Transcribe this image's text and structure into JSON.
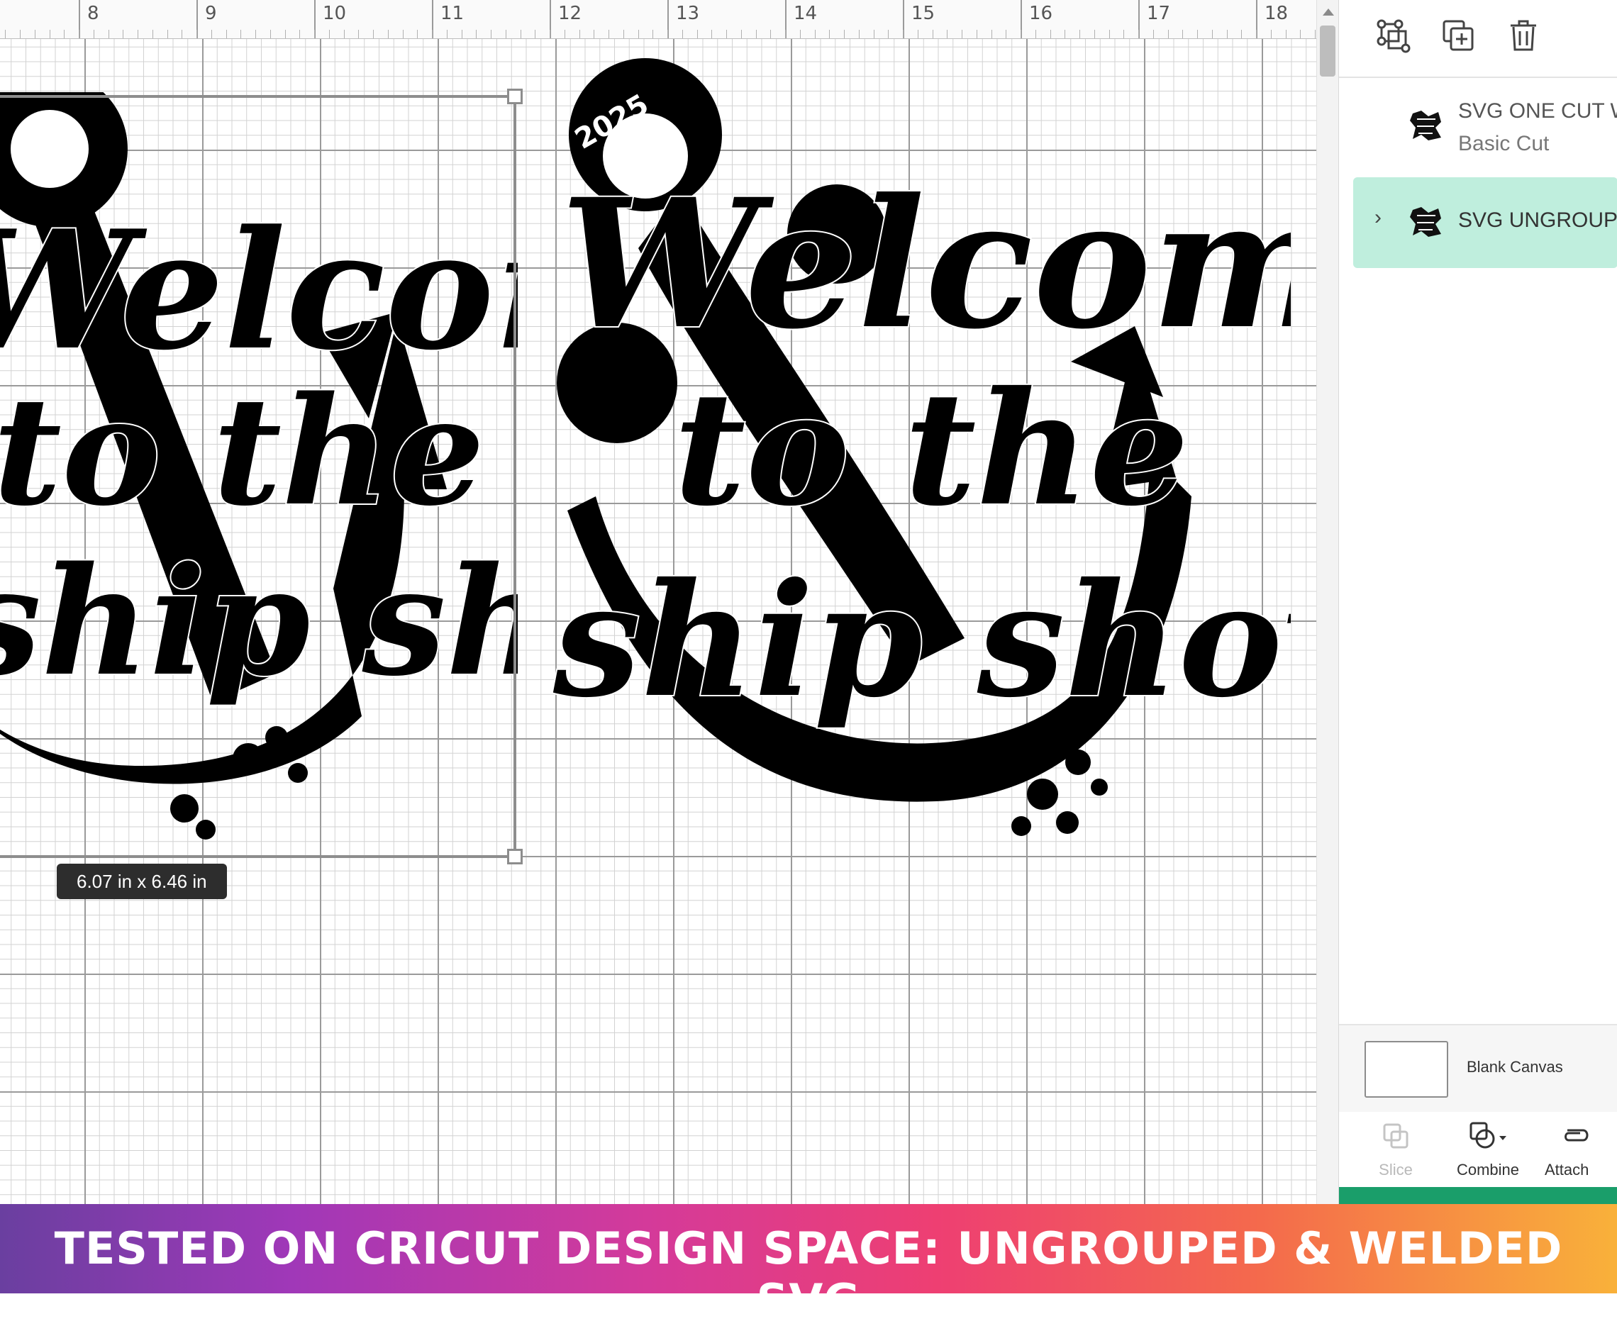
{
  "ruler": {
    "marks": [
      "8",
      "9",
      "10",
      "11",
      "12",
      "13",
      "14",
      "15",
      "16",
      "17",
      "18"
    ]
  },
  "design": {
    "year": "2025",
    "line1": "Welcome",
    "line2": "to the",
    "line3": "ship show"
  },
  "selection": {
    "size_label": "6.07  in x 6.46  in"
  },
  "panel": {
    "toolbar": [
      {
        "icon": "group-icon"
      },
      {
        "icon": "duplicate-icon"
      },
      {
        "icon": "delete-icon"
      }
    ],
    "layers": [
      {
        "title": "SVG ONE CUT W",
        "subtitle": "Basic Cut"
      },
      {
        "title": "SVG UNGROUP"
      }
    ],
    "canvas_label": "Blank Canvas",
    "actions": [
      {
        "label": "Slice",
        "enabled": false
      },
      {
        "label": "Combine",
        "enabled": true
      },
      {
        "label": "Attach",
        "enabled": true
      }
    ]
  },
  "colors": {
    "selected_layer": "#bfeedd",
    "accent_green": "#1a9e6a"
  },
  "banner": {
    "text": "TESTED ON CRICUT DESIGN SPACE: UNGROUPED & WELDED SVG"
  }
}
